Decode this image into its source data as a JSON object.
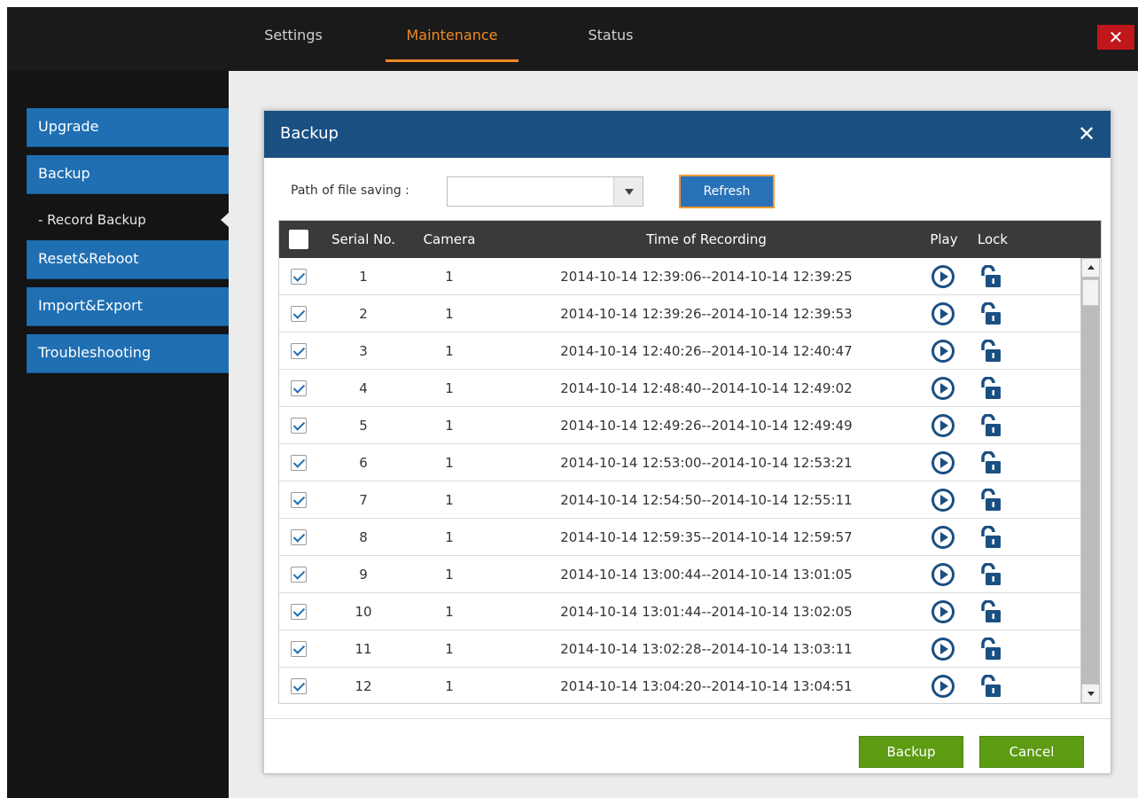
{
  "topbar": {
    "tabs": [
      {
        "label": "Settings",
        "active": false
      },
      {
        "label": "Maintenance",
        "active": true
      },
      {
        "label": "Status",
        "active": false
      }
    ],
    "close_icon": "close-icon"
  },
  "sidebar": {
    "items": [
      {
        "label": "Upgrade"
      },
      {
        "label": "Backup"
      },
      {
        "label": "- Record Backup",
        "sub": true,
        "selected": true
      },
      {
        "label": "Reset&Reboot"
      },
      {
        "label": "Import&Export"
      },
      {
        "label": "Troubleshooting"
      }
    ]
  },
  "dialog": {
    "title": "Backup",
    "path_label": "Path of file saving :",
    "path_value": "",
    "refresh_label": "Refresh",
    "backup_label": "Backup",
    "cancel_label": "Cancel"
  },
  "table": {
    "columns": [
      "Serial No.",
      "Camera",
      "Time of Recording",
      "Play",
      "Lock"
    ],
    "rows": [
      {
        "serial": "1",
        "camera": "1",
        "time": "2014-10-14 12:39:06--2014-10-14 12:39:25",
        "checked": true
      },
      {
        "serial": "2",
        "camera": "1",
        "time": "2014-10-14 12:39:26--2014-10-14 12:39:53",
        "checked": true
      },
      {
        "serial": "3",
        "camera": "1",
        "time": "2014-10-14 12:40:26--2014-10-14 12:40:47",
        "checked": true
      },
      {
        "serial": "4",
        "camera": "1",
        "time": "2014-10-14 12:48:40--2014-10-14 12:49:02",
        "checked": true
      },
      {
        "serial": "5",
        "camera": "1",
        "time": "2014-10-14 12:49:26--2014-10-14 12:49:49",
        "checked": true
      },
      {
        "serial": "6",
        "camera": "1",
        "time": "2014-10-14 12:53:00--2014-10-14 12:53:21",
        "checked": true
      },
      {
        "serial": "7",
        "camera": "1",
        "time": "2014-10-14 12:54:50--2014-10-14 12:55:11",
        "checked": true
      },
      {
        "serial": "8",
        "camera": "1",
        "time": "2014-10-14 12:59:35--2014-10-14 12:59:57",
        "checked": true
      },
      {
        "serial": "9",
        "camera": "1",
        "time": "2014-10-14 13:00:44--2014-10-14 13:01:05",
        "checked": true
      },
      {
        "serial": "10",
        "camera": "1",
        "time": "2014-10-14 13:01:44--2014-10-14 13:02:05",
        "checked": true
      },
      {
        "serial": "11",
        "camera": "1",
        "time": "2014-10-14 13:02:28--2014-10-14 13:03:11",
        "checked": true
      },
      {
        "serial": "12",
        "camera": "1",
        "time": "2014-10-14 13:04:20--2014-10-14 13:04:51",
        "checked": true
      }
    ]
  },
  "colors": {
    "accent": "#f08a24",
    "sidebar_item": "#1f6fb2",
    "dialog_header": "#1a4f82",
    "button_green": "#5c9b12",
    "close_red": "#c0171d"
  }
}
